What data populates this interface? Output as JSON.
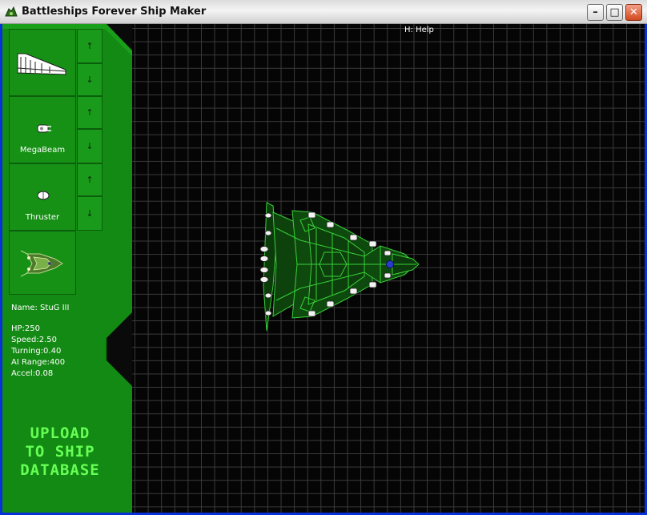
{
  "window": {
    "title": "Battleships Forever Ship Maker",
    "minimize_glyph": "–",
    "maximize_glyph": "□",
    "close_glyph": "✕"
  },
  "grid": {
    "help": "H: Help"
  },
  "parts": [
    {
      "label": "",
      "icon": "hull-section-icon"
    },
    {
      "label": "MegaBeam",
      "icon": "megabeam-icon"
    },
    {
      "label": "Thruster",
      "icon": "thruster-icon"
    },
    {
      "label": "",
      "icon": "ship-preview-icon"
    }
  ],
  "arrows": {
    "up": "↑",
    "down": "↓"
  },
  "ship": {
    "name_line": "Name: StuG III",
    "hp": "HP:250",
    "speed": "Speed:2.50",
    "turning": "Turning:0.40",
    "ai_range": "AI Range:400",
    "accel": "Accel:0.08"
  },
  "upload": {
    "line1": "UPLOAD",
    "line2": "TO SHIP",
    "line3": "DATABASE"
  },
  "colors": {
    "sidebar": "#138a13",
    "accent": "#66ff55",
    "grid_line": "#3b3b3b"
  }
}
